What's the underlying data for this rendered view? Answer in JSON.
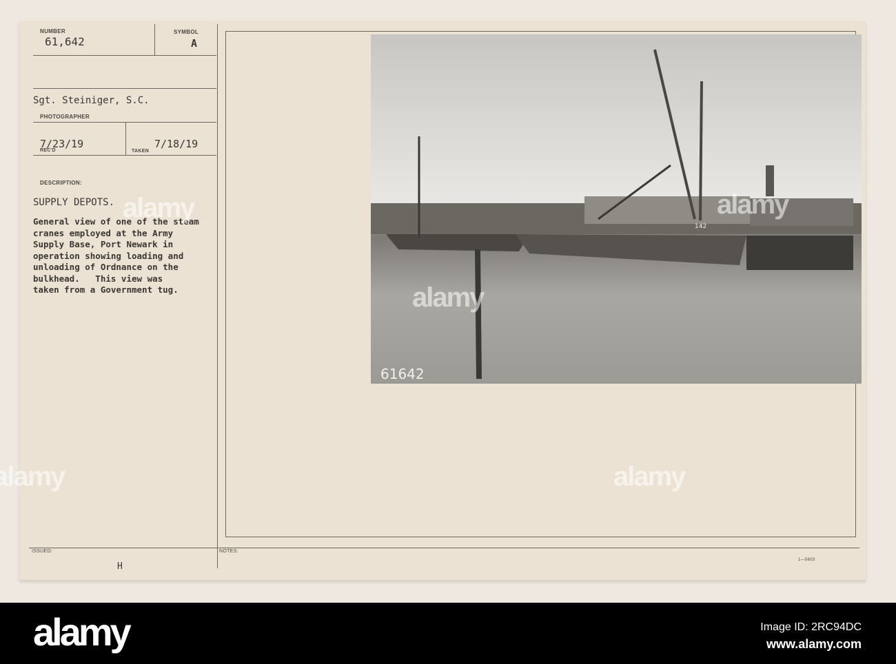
{
  "card": {
    "number_label": "NUMBER",
    "number": "61,642",
    "symbol_label": "SYMBOL",
    "symbol": "A",
    "photographer": "Sgt. Steiniger, S.C.",
    "photographer_label": "PHOTOGRAPHER",
    "received_date": "7/23/19",
    "received_label": "REC'D",
    "taken_label": "TAKEN",
    "taken_date": "7/18/19",
    "description_label": "DESCRIPTION:",
    "title": "SUPPLY DEPOTS.",
    "description_lines": [
      "General view of one of the steam",
      "cranes employed at the Army",
      "Supply Base, Port Newark in",
      "operation showing loading and",
      "unloading of Ordnance on the",
      "bulkhead.   This view was",
      "taken from a Government tug."
    ],
    "issued_label": "ISSUED:",
    "issued_value": "H",
    "notes_label": "NOTES:",
    "form_number": "1—5603",
    "photo_handwritten_number": "61642",
    "photo_barge_number": "142"
  },
  "watermark": "alamy",
  "footer": {
    "logo": "alamy",
    "image_id": "Image ID: 2RC94DC",
    "url": "www.alamy.com"
  }
}
